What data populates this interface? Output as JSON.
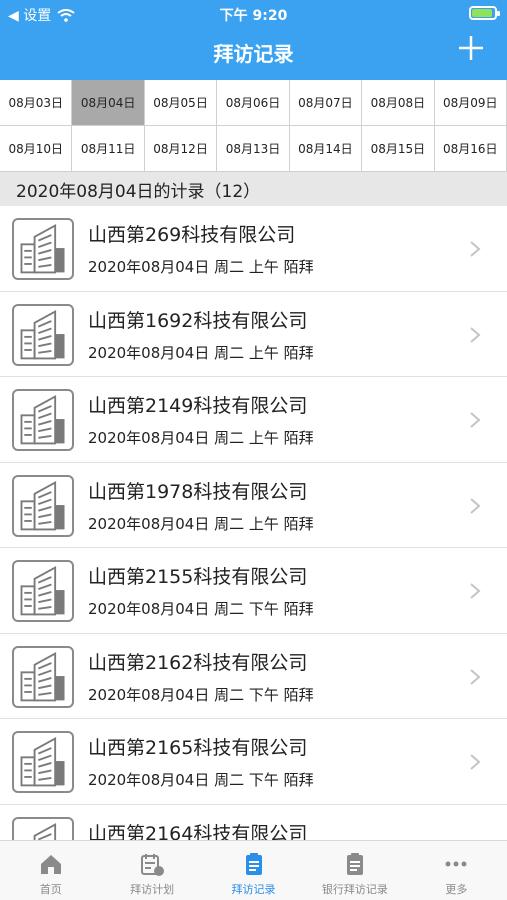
{
  "status": {
    "back_label": "◀ 设置",
    "time": "下午 9:20"
  },
  "header": {
    "title": "拜访记录",
    "add_icon": "plus-icon"
  },
  "dates": [
    "08月03日",
    "08月04日",
    "08月05日",
    "08月06日",
    "08月07日",
    "08月08日",
    "08月09日",
    "08月10日",
    "08月11日",
    "08月12日",
    "08月13日",
    "08月14日",
    "08月15日",
    "08月16日"
  ],
  "selected_date_index": 1,
  "section": {
    "label": "2020年08月04日的计录（12）"
  },
  "records": [
    {
      "name": "山西第269科技有限公司",
      "sub": "2020年08月04日 周二 上午 陌拜"
    },
    {
      "name": "山西第1692科技有限公司",
      "sub": "2020年08月04日 周二 上午 陌拜"
    },
    {
      "name": "山西第2149科技有限公司",
      "sub": "2020年08月04日 周二 上午 陌拜"
    },
    {
      "name": "山西第1978科技有限公司",
      "sub": "2020年08月04日 周二 上午 陌拜"
    },
    {
      "name": "山西第2155科技有限公司",
      "sub": "2020年08月04日 周二 下午 陌拜"
    },
    {
      "name": "山西第2162科技有限公司",
      "sub": "2020年08月04日 周二 下午 陌拜"
    },
    {
      "name": "山西第2165科技有限公司",
      "sub": "2020年08月04日 周二 下午 陌拜"
    },
    {
      "name": "山西第2164科技有限公司",
      "sub": ""
    }
  ],
  "tabs": [
    {
      "label": "首页",
      "icon": "home-icon"
    },
    {
      "label": "拜访计划",
      "icon": "calendar-clock-icon"
    },
    {
      "label": "拜访记录",
      "icon": "clipboard-icon",
      "active": true
    },
    {
      "label": "银行拜访记录",
      "icon": "clipboard-list-icon"
    },
    {
      "label": "更多",
      "icon": "more-icon"
    }
  ],
  "colors": {
    "accent": "#3aa2f0",
    "tab_active": "#2b8ee8",
    "selected_date": "#a9a9a9"
  }
}
